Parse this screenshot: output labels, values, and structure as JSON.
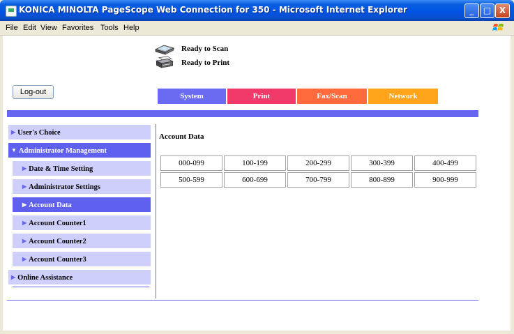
{
  "window": {
    "title": "KONICA MINOLTA PageScope Web Connection for 350 - Microsoft Internet Explorer",
    "controls": {
      "minimize": "_",
      "maximize": "□",
      "close": "X"
    }
  },
  "menubar": {
    "items": [
      "File",
      "Edit",
      "View",
      "Favorites",
      "Tools",
      "Help"
    ]
  },
  "status": {
    "scan": "Ready to Scan",
    "print": "Ready to Print"
  },
  "logout_label": "Log-out",
  "tabs": [
    {
      "label": "System",
      "color": "#6A6AF2"
    },
    {
      "label": "Print",
      "color": "#F23A6A"
    },
    {
      "label": "Fax/Scan",
      "color": "#FF6A3D"
    },
    {
      "label": "Network",
      "color": "#FFA31A"
    }
  ],
  "nav": {
    "users_choice": "User's Choice",
    "admin_management": "Administrator Management",
    "date_time": "Date & Time Setting",
    "admin_settings": "Administrator Settings",
    "account_data": "Account Data",
    "account_counter1": "Account Counter1",
    "account_counter2": "Account Counter2",
    "account_counter3": "Account Counter3",
    "online_assistance": "Online Assistance"
  },
  "main": {
    "title": "Account Data",
    "ranges": [
      [
        "000-099",
        "100-199",
        "200-299",
        "300-399",
        "400-499"
      ],
      [
        "500-599",
        "600-699",
        "700-799",
        "800-899",
        "900-999"
      ]
    ]
  },
  "colors": {
    "accent_band": "#6666F0",
    "nav_light": "#CFCFFB",
    "nav_active": "#6060EF"
  }
}
